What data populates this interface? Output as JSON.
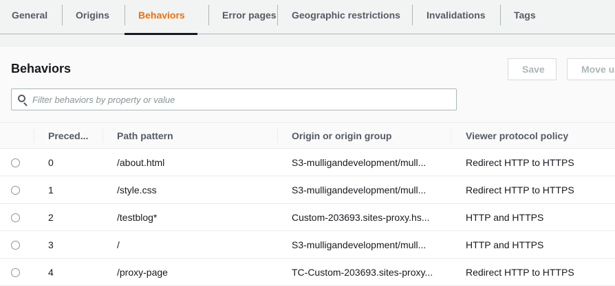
{
  "tabs": [
    "General",
    "Origins",
    "Behaviors",
    "Error pages",
    "Geographic restrictions",
    "Invalidations",
    "Tags"
  ],
  "active_tab": "Behaviors",
  "accent_color": "#ec7211",
  "section": {
    "title": "Behaviors",
    "save_label": "Save",
    "move_up_label": "Move up"
  },
  "filter": {
    "placeholder": "Filter behaviors by property or value",
    "value": ""
  },
  "table": {
    "columns": [
      "Preced...",
      "Path pattern",
      "Origin or origin group",
      "Viewer protocol policy"
    ],
    "rows": [
      {
        "precedence": "0",
        "path": "/about.html",
        "origin": "S3-mulligandevelopment/mull...",
        "policy": "Redirect HTTP to HTTPS"
      },
      {
        "precedence": "1",
        "path": "/style.css",
        "origin": "S3-mulligandevelopment/mull...",
        "policy": "Redirect HTTP to HTTPS"
      },
      {
        "precedence": "2",
        "path": "/testblog*",
        "origin": "Custom-203693.sites-proxy.hs...",
        "policy": "HTTP and HTTPS"
      },
      {
        "precedence": "3",
        "path": "/",
        "origin": "S3-mulligandevelopment/mull...",
        "policy": "HTTP and HTTPS"
      },
      {
        "precedence": "4",
        "path": "/proxy-page",
        "origin": "TC-Custom-203693.sites-proxy...",
        "policy": "Redirect HTTP to HTTPS"
      }
    ]
  }
}
